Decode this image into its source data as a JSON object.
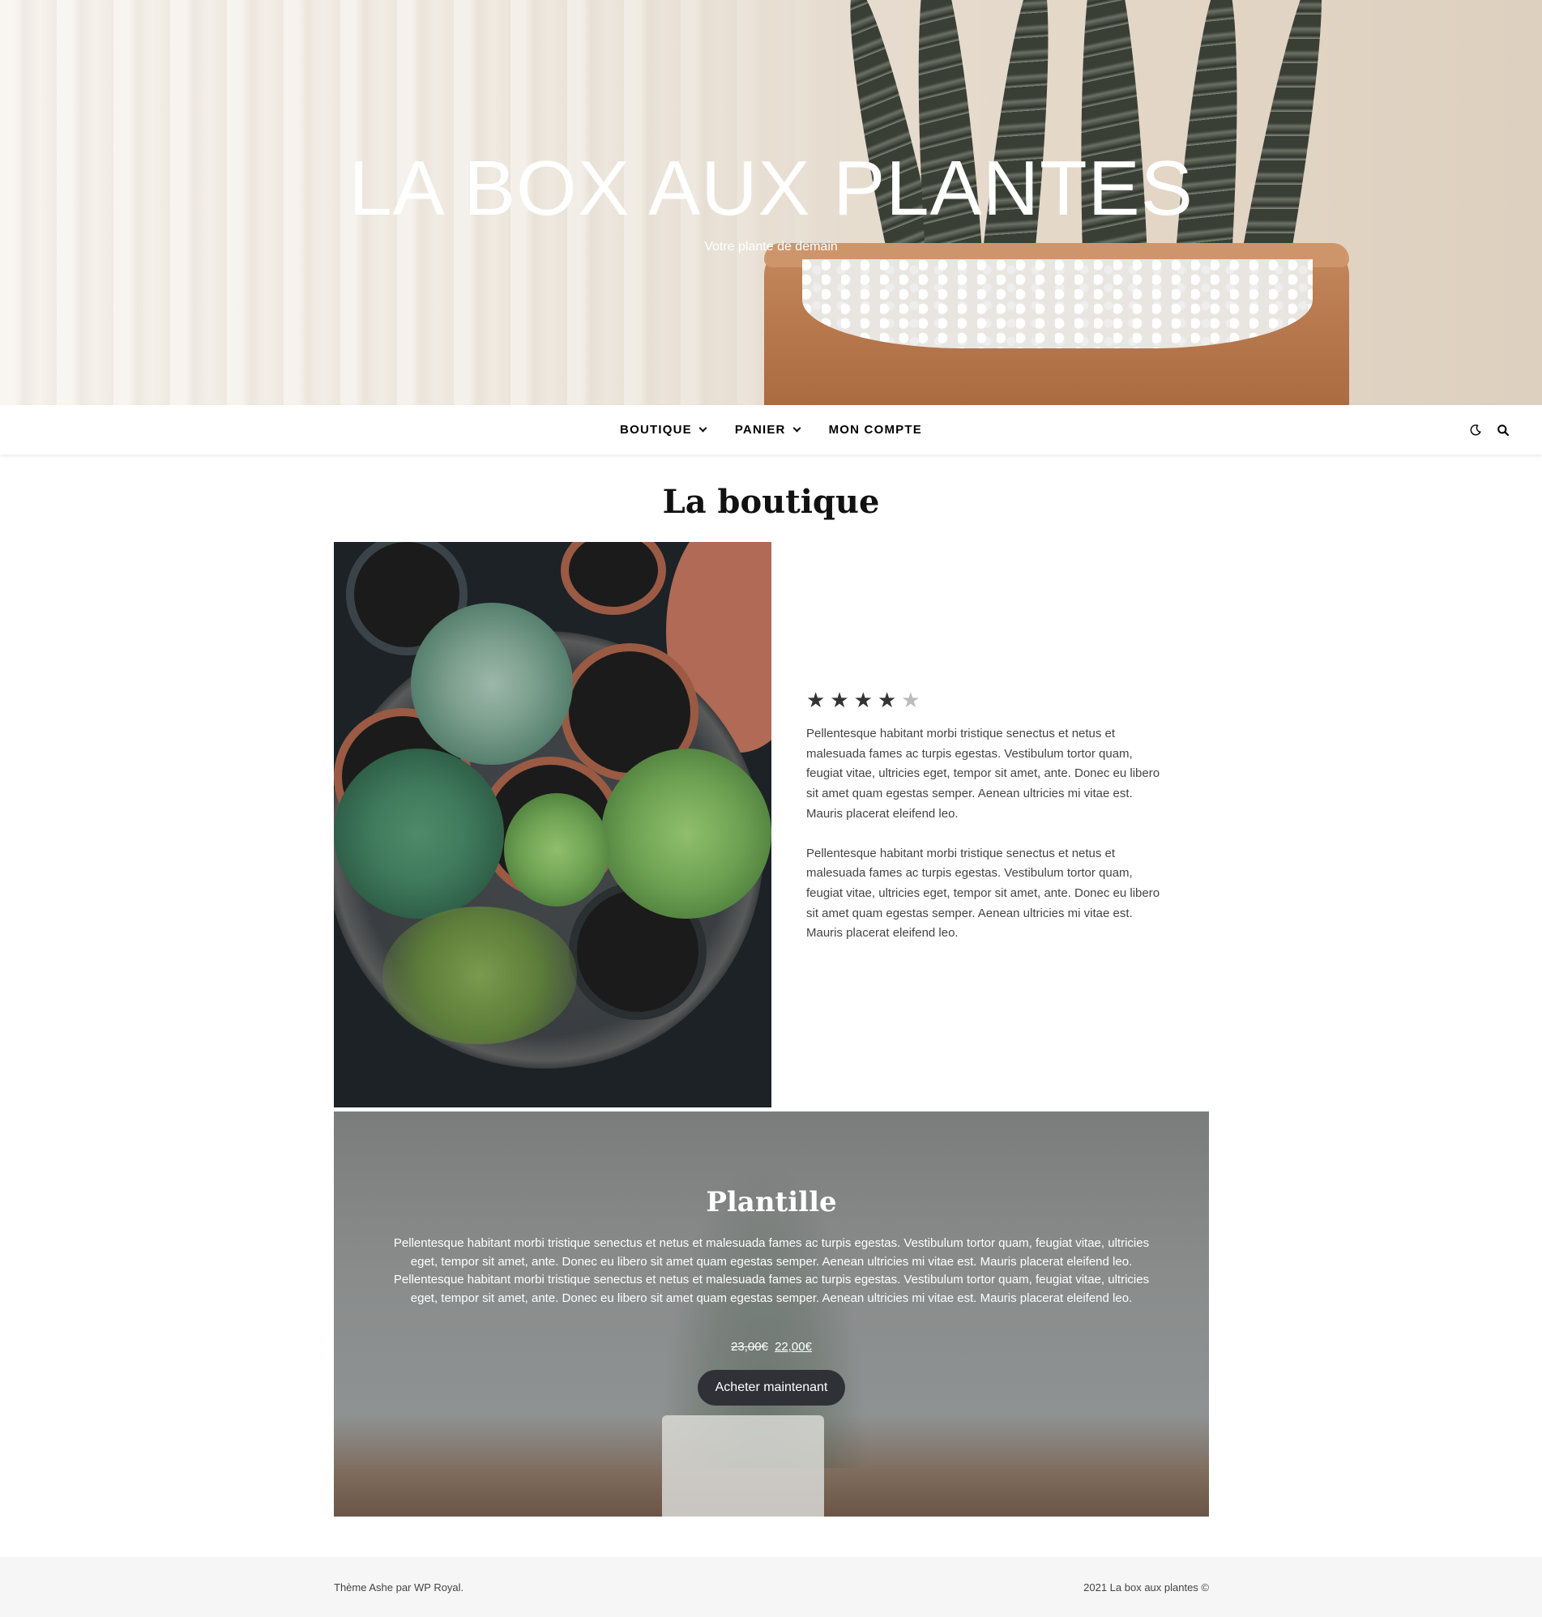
{
  "hero": {
    "site_title": "LA BOX AUX PLANTES",
    "tagline": "Votre plante de demain"
  },
  "nav": {
    "items": [
      {
        "label": "BOUTIQUE",
        "has_dropdown": true
      },
      {
        "label": "PANIER",
        "has_dropdown": true
      },
      {
        "label": "MON COMPTE",
        "has_dropdown": false
      }
    ],
    "icons": [
      "moon-icon",
      "search-icon"
    ]
  },
  "page": {
    "title": "La boutique"
  },
  "product": {
    "rating": {
      "value": 4,
      "max": 5
    },
    "description": [
      "Pellentesque habitant morbi tristique senectus et netus et malesuada fames ac turpis egestas. Vestibulum tortor quam, feugiat vitae, ultricies eget, tempor sit amet, ante. Donec eu libero sit amet quam egestas semper. Aenean ultricies mi vitae est. Mauris placerat eleifend leo.",
      "Pellentesque habitant morbi tristique senectus et netus et malesuada fames ac turpis egestas. Vestibulum tortor quam, feugiat vitae, ultricies eget, tempor sit amet, ante. Donec eu libero sit amet quam egestas semper. Aenean ultricies mi vitae est. Mauris placerat eleifend leo."
    ]
  },
  "banner": {
    "title": "Plantille",
    "paragraphs": [
      "Pellentesque habitant morbi tristique senectus et netus et malesuada fames ac turpis egestas. Vestibulum tortor quam, feugiat vitae, ultricies eget, tempor sit amet, ante. Donec eu libero sit amet quam egestas semper. Aenean ultricies mi vitae est. Mauris placerat eleifend leo.",
      "Pellentesque habitant morbi tristique senectus et netus et malesuada fames ac turpis egestas. Vestibulum tortor quam, feugiat vitae, ultricies eget, tempor sit amet, ante. Donec eu libero sit amet quam egestas semper. Aenean ultricies mi vitae est. Mauris placerat eleifend leo."
    ],
    "old_price": "23,00€",
    "price": "22,00€",
    "button_label": "Acheter maintenant"
  },
  "footer": {
    "left": "Thème Ashe par WP Royal.",
    "right": "2021 La box aux plantes ©"
  },
  "colors": {
    "button_bg": "#2f3136",
    "footer_bg": "#f6f6f6",
    "star_filled": "#333333",
    "star_empty": "#bbbbbb"
  }
}
